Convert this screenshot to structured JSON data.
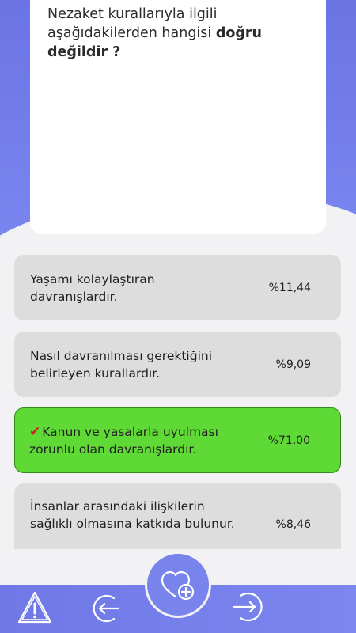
{
  "question": {
    "text_before": "Nezaket kurallarıyla ilgili aşağıdakilerden hangisi ",
    "text_bold": "doğru değildir ?"
  },
  "answers": [
    {
      "text": "Yaşamı kolaylaştıran davranışlardır.",
      "percent": "%11,44",
      "correct": false
    },
    {
      "text": "Nasıl davranılması gerektiğini belirleyen kurallardır.",
      "percent": "%9,09",
      "correct": false
    },
    {
      "text": "Kanun ve yasalarla uyulması zorunlu olan davranışlardır.",
      "percent": "%71,00",
      "correct": true
    },
    {
      "text": "İnsanlar arasındaki ilişkilerin sağlıklı olmasına katkıda bulunur.",
      "percent": "%8,46",
      "correct": false
    }
  ],
  "correct_mark": "✔",
  "icons": {
    "report": "warning-triangle-icon",
    "back": "arrow-left-circle-icon",
    "favorite": "heart-plus-icon",
    "next": "arrow-right-circle-icon"
  },
  "colors": {
    "accent": "#7a86f0",
    "correct": "#5fd935",
    "answer_bg": "#dddddd",
    "check": "#c81e1e"
  }
}
